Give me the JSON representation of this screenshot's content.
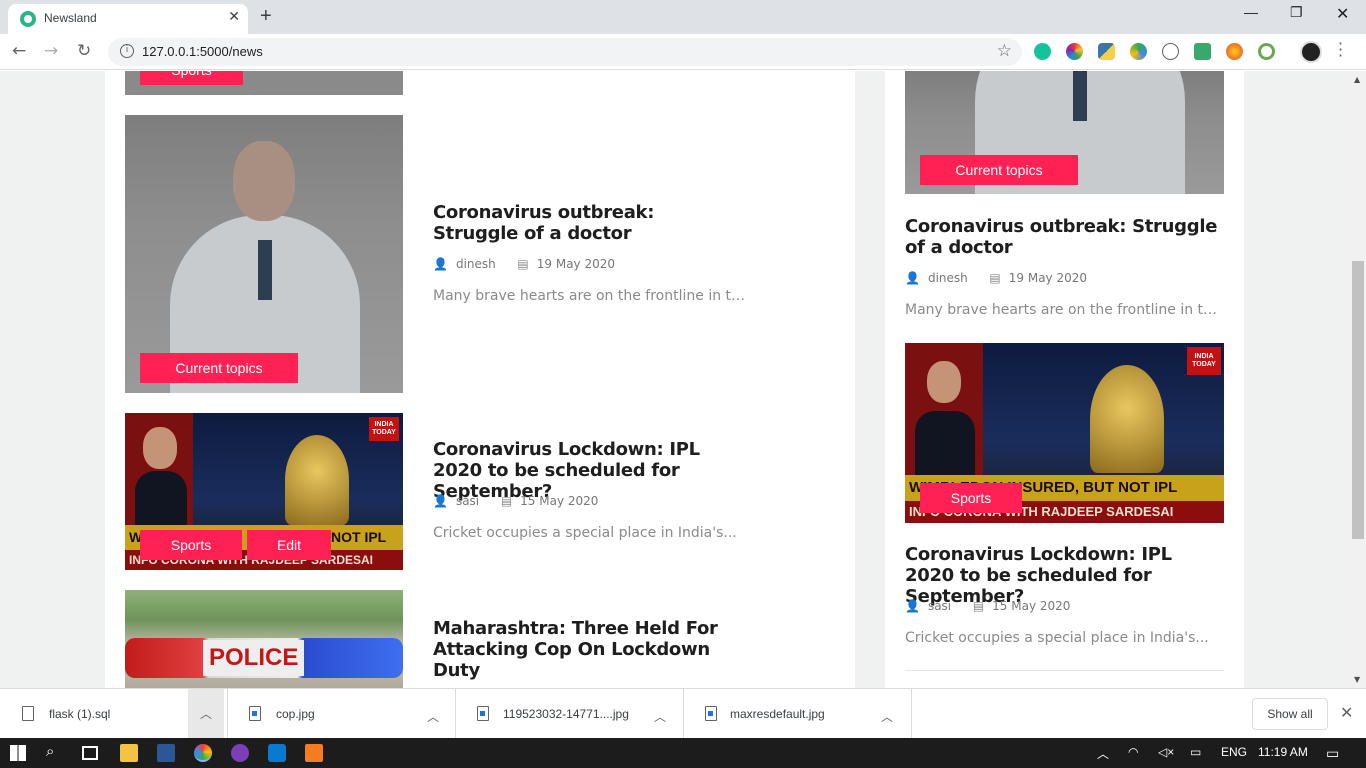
{
  "browser": {
    "tab_title": "Newsland",
    "url": "127.0.0.1:5000/news"
  },
  "main_feed": [
    {
      "title": "Coronavirus outbreak: Struggle of a doctor",
      "author": "dinesh",
      "date": "19 May 2020",
      "excerpt": "Many brave hearts are on the frontline in the...",
      "tags": [
        "Current topics"
      ]
    },
    {
      "title": "Coronavirus Lockdown: IPL 2020 to be scheduled for September?",
      "author": "sasi",
      "date": "15 May 2020",
      "excerpt": "Cricket occupies a special place in India's...",
      "tags": [
        "Sports",
        "Edit"
      ]
    },
    {
      "title": "Maharashtra: Three Held For Attacking Cop On Lockdown Duty"
    }
  ],
  "top_partial_tag": "Sports",
  "sidebar_feed": [
    {
      "tag": "Current topics",
      "title": "Coronavirus outbreak: Struggle of a doctor",
      "author": "dinesh",
      "date": "19 May 2020",
      "excerpt": "Many brave hearts are on the frontline in the..."
    },
    {
      "tag": "Sports",
      "title": "Coronavirus Lockdown: IPL 2020 to be scheduled for September?",
      "author": "sasi",
      "date": "15 May 2020",
      "excerpt": "Cricket occupies a special place in India's..."
    }
  ],
  "image_text": {
    "ipl_banner_main": "WIMBLEDON INSURED, BUT NOT IPL",
    "ipl_banner_main_cropped": "W",
    "ipl_banner_main_tail": "NOT IPL",
    "ipl_banner_sub": "INFO CORONA WITH RAJDEEP SARDESAI",
    "ipl_logo": "INDIA TODAY",
    "police_sign": "POLICE"
  },
  "downloads": [
    {
      "name": "flask (1).sql"
    },
    {
      "name": "cop.jpg"
    },
    {
      "name": "119523032-14771....jpg"
    },
    {
      "name": "maxresdefault.jpg"
    }
  ],
  "downloads_show_all": "Show all",
  "taskbar": {
    "language": "ENG",
    "time": "11:19 AM"
  },
  "colors": {
    "tag_bg": "#ff2154",
    "page_bg": "#f0f2f2"
  }
}
